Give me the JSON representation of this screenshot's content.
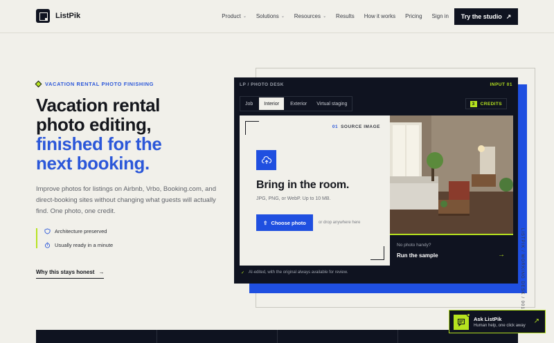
{
  "brand": {
    "name": "ListPik"
  },
  "nav": {
    "items": [
      {
        "label": "Product",
        "dropdown": true
      },
      {
        "label": "Solutions",
        "dropdown": true
      },
      {
        "label": "Resources",
        "dropdown": true
      },
      {
        "label": "Results",
        "dropdown": false
      },
      {
        "label": "How it works",
        "dropdown": false
      },
      {
        "label": "Pricing",
        "dropdown": false
      },
      {
        "label": "Sign in",
        "dropdown": false
      }
    ],
    "cta": "Try the studio"
  },
  "hero": {
    "eyebrow": "VACATION RENTAL PHOTO FINISHING",
    "headline_line1": "Vacation rental",
    "headline_line2": "photo editing,",
    "headline_line3": "finished for the",
    "headline_line4": "next booking.",
    "description": "Improve photos for listings on Airbnb, Vrbo, Booking.com, and direct-booking sites without changing what guests will actually find. One photo, one credit.",
    "feature1": "Architecture preserved",
    "feature2": "Usually ready in a minute",
    "why_link": "Why this stays honest"
  },
  "desk": {
    "label": "LP / PHOTO DESK",
    "input": "INPUT 01",
    "tabs": [
      "Job",
      "Interior",
      "Exterior",
      "Virtual staging"
    ],
    "active_tab": "Interior",
    "credits_count": "3",
    "credits_label": "CREDITS",
    "source_num": "01",
    "source_label": "SOURCE IMAGE",
    "title": "Bring in the room.",
    "formats": "JPG, PNG, or WebP. Up to 10 MB.",
    "choose": "Choose photo",
    "drop": "or drop anywhere here",
    "no_photo": "No photo handy?",
    "run_sample": "Run the sample",
    "footer": "AI-edited, with the original always available for review.",
    "vertical": "LISTPIK / WORKING DESK / 001"
  },
  "chat": {
    "title": "Ask ListPik",
    "subtitle": "Human help, one click away"
  },
  "colors": {
    "accent_blue": "#1f4fe0",
    "lime": "#b6e31f",
    "navy": "#0f1320",
    "paper": "#f1f0ea"
  }
}
